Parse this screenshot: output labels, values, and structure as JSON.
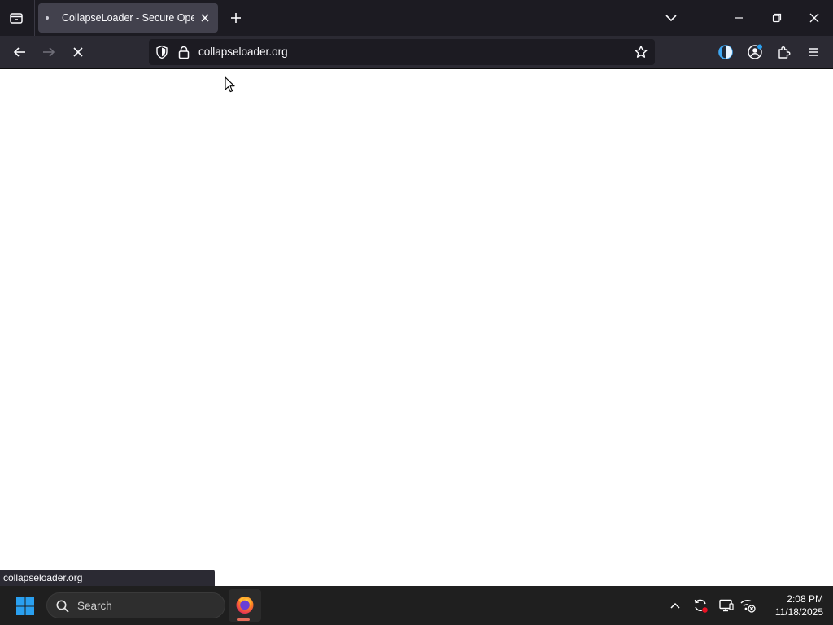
{
  "tabstrip": {
    "active_tab_title": "CollapseLoader - Secure Open Source",
    "icons": [
      "tab-overview-icon",
      "close-icon",
      "plus-icon",
      "chevron-down-icon",
      "minimize-icon",
      "restore-icon",
      "close-icon"
    ]
  },
  "navbar": {
    "url": "collapseloader.org",
    "icons": [
      "back-arrow-icon",
      "forward-arrow-icon",
      "stop-icon",
      "shield-icon",
      "lock-icon",
      "star-icon",
      "dark-mode-icon",
      "account-icon",
      "puzzle-icon",
      "hamburger-menu-icon"
    ]
  },
  "status": {
    "link_text": "collapseloader.org"
  },
  "taskbar": {
    "search_placeholder": "Search",
    "time": "2:08 PM",
    "date": "11/18/2025"
  },
  "colors": {
    "tabstrip_bg": "#1c1b22",
    "navbar_bg": "#2b2a33",
    "taskbar_bg": "#1f1f1f",
    "windows_blue": "#2aa0f0"
  }
}
